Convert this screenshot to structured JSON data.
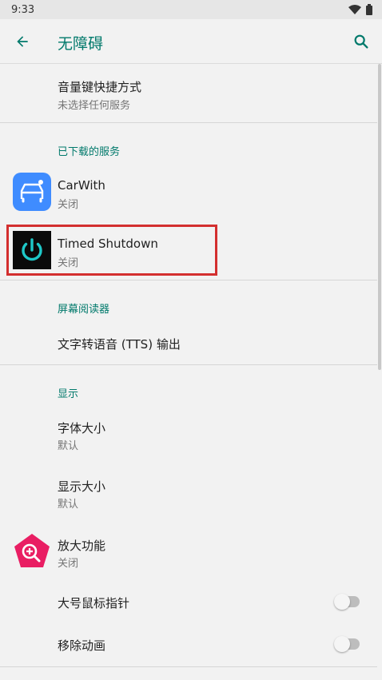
{
  "status_bar": {
    "time": "9:33"
  },
  "app_bar": {
    "title": "无障碍"
  },
  "items": {
    "volume_shortcut": {
      "title": "音量键快捷方式",
      "subtitle": "未选择任何服务"
    },
    "carwith": {
      "title": "CarWith",
      "subtitle": "关闭"
    },
    "timed_shutdown": {
      "title": "Timed Shutdown",
      "subtitle": "关闭"
    },
    "tts_output": {
      "title": "文字转语音 (TTS) 输出"
    },
    "font_size": {
      "title": "字体大小",
      "subtitle": "默认"
    },
    "display_size": {
      "title": "显示大小",
      "subtitle": "默认"
    },
    "magnification": {
      "title": "放大功能",
      "subtitle": "关闭"
    },
    "large_pointer": {
      "title": "大号鼠标指针",
      "enabled": false
    },
    "remove_animations": {
      "title": "移除动画",
      "enabled": false
    }
  },
  "sections": {
    "downloaded_services": "已下载的服务",
    "screen_readers": "屏幕阅读器",
    "display": "显示"
  },
  "colors": {
    "accent": "#00796b",
    "highlight": "#d32f2f",
    "carwith_icon": "#3f8cff",
    "magnify_icon": "#e91e63"
  },
  "icons": {
    "back": "arrow-back-icon",
    "search": "search-icon",
    "wifi": "wifi-icon",
    "battery": "battery-icon"
  }
}
